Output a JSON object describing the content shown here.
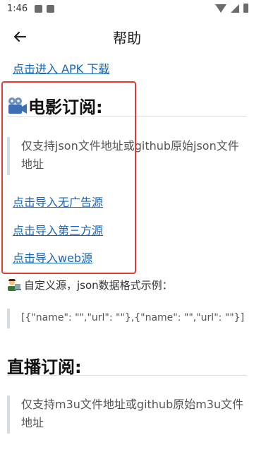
{
  "status_bar": {
    "time": "1:46"
  },
  "app_bar": {
    "title": "帮助"
  },
  "content": {
    "apk_link": "点击进入 APK 下载",
    "movie_section": {
      "heading": "电影订阅:",
      "quote": "仅支持json文件地址或github原始json文件地址",
      "links": [
        "点击导入无广告源",
        "点击导入第三方源",
        "点击导入web源"
      ]
    },
    "custom_source_text": "自定义源，json数据格式示例：",
    "json_example": "[{\"name\": \"\",\"url\": \"\"},{\"name\": \"\",\"url\": \"\"}]",
    "live_section": {
      "heading": "直播订阅:",
      "quote": "仅支持m3u文件地址或github原始m3u文件地址"
    }
  },
  "colors": {
    "link": "#1565c0",
    "highlight_box": "#e53935",
    "quote_bar": "#d7dbe2"
  }
}
